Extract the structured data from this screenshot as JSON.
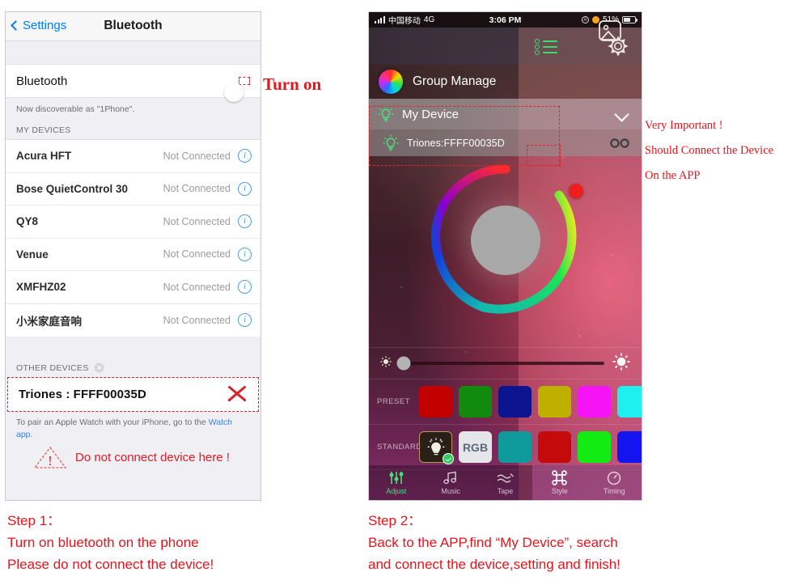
{
  "left_phone": {
    "nav": {
      "back_label": "Settings",
      "title": "Bluetooth"
    },
    "bluetooth_row": {
      "label": "Bluetooth",
      "toggle_state": "on",
      "toggle_color": "#4cd964"
    },
    "discoverable_text": "Now discoverable as \"1Phone\".",
    "my_devices_header": "MY DEVICES",
    "my_devices": [
      {
        "name": "Acura HFT",
        "status": "Not Connected"
      },
      {
        "name": "Bose QuietControl 30",
        "status": "Not Connected"
      },
      {
        "name": "QY8",
        "status": "Not Connected"
      },
      {
        "name": "Venue",
        "status": "Not Connected"
      },
      {
        "name": "XMFHZ02",
        "status": "Not Connected"
      },
      {
        "name": "小米家庭音响",
        "status": "Not Connected"
      }
    ],
    "other_devices_header": "OTHER DEVICES",
    "other_device": {
      "name": "Triones : FFFF00035D"
    },
    "pair_note": "To pair an Apple Watch with your iPhone, go to the ",
    "pair_note_link": "Watch app",
    "pair_note_end": ".",
    "warning_text": "Do not connect device here !"
  },
  "annotations": {
    "turn_on": "Turn on",
    "right_notes": [
      "Very Important !",
      "Should Connect the Device",
      "On the APP"
    ],
    "accent_red": "#e8141c"
  },
  "right_phone": {
    "statusbar": {
      "carrier": "中国移动",
      "network": "4G",
      "time": "3:06 PM",
      "battery_percent": "51%",
      "lock_glyph": "A"
    },
    "topbar": {
      "list_icon": "list-icon",
      "gear_icon": "gear-icon"
    },
    "header": {
      "title": "Group Manage",
      "image_icon": "image-icon"
    },
    "device_group": {
      "group_label": "My Device",
      "device_label": "Triones:FFFF00035D",
      "link_icon": "link-icon",
      "expanded": true
    },
    "color_wheel": {
      "center_color": "#a8a8a8",
      "handle_color": "#f01d1d"
    },
    "brightness": {
      "value_percent": 2,
      "low_icon": "sun-small-icon",
      "high_icon": "sun-large-icon"
    },
    "preset": {
      "label": "PRESET",
      "colors": [
        "#c20000",
        "#128a0e",
        "#0d1490",
        "#bfb000",
        "#f613f6",
        "#1ef0ef"
      ]
    },
    "standard": {
      "label": "STANDARD",
      "items": [
        {
          "type": "bulb",
          "label": "",
          "selected": true,
          "color": "#2b2018"
        },
        {
          "type": "rgb",
          "label": "RGB",
          "selected": false,
          "color": "#e4e6ea"
        },
        {
          "type": "color",
          "label": "",
          "selected": false,
          "color": "#0f9b9b"
        },
        {
          "type": "color",
          "label": "",
          "selected": false,
          "color": "#c40a0a"
        },
        {
          "type": "color",
          "label": "",
          "selected": false,
          "color": "#13ec13"
        },
        {
          "type": "color",
          "label": "",
          "selected": false,
          "color": "#1414f0"
        }
      ]
    },
    "tabs": [
      {
        "label": "Adjust",
        "active": true
      },
      {
        "label": "Music",
        "active": false
      },
      {
        "label": "Tape",
        "active": false
      },
      {
        "label": "Style",
        "active": false
      },
      {
        "label": "Timing",
        "active": false
      }
    ]
  },
  "captions": {
    "step1": {
      "title": "Step 1：",
      "line1": "Turn on bluetooth on the phone",
      "line2": "Please do not connect the device!"
    },
    "step2": {
      "title": "Step 2：",
      "line1": "Back to the APP,find “My Device”, search",
      "line2": "and connect the device,setting and finish!"
    }
  }
}
